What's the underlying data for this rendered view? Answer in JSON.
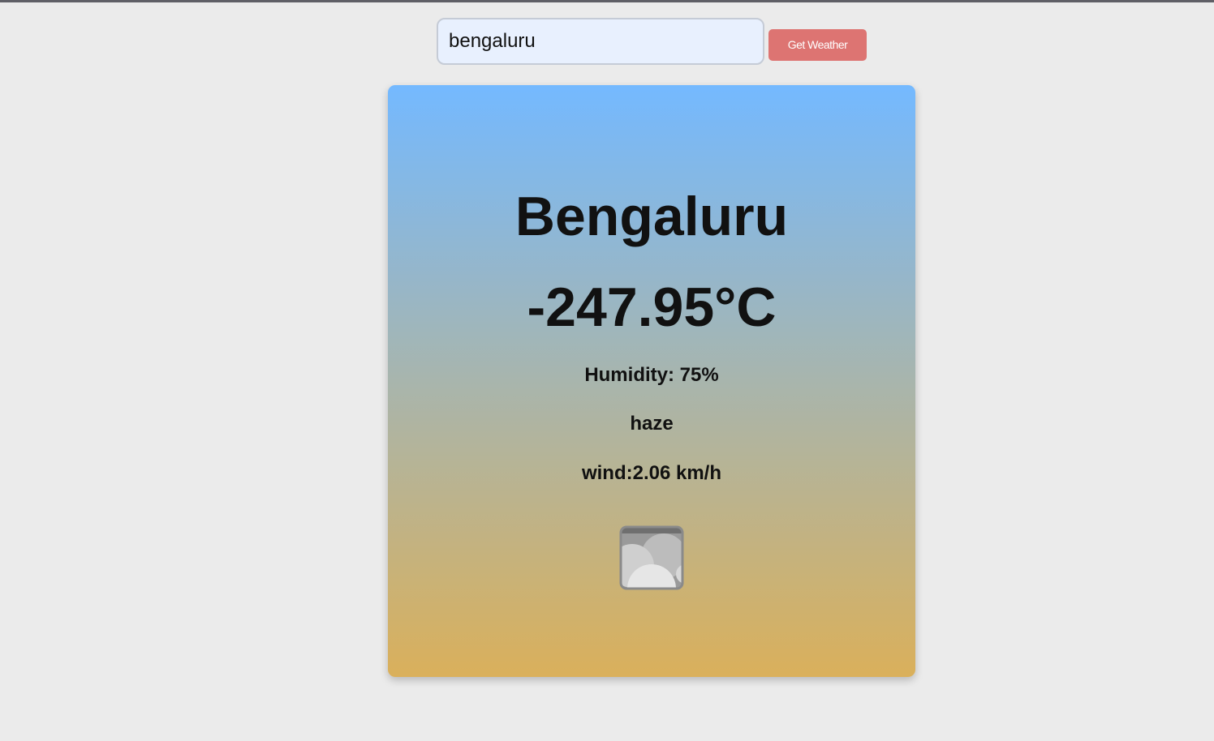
{
  "search": {
    "value": "bengaluru",
    "button_label": "Get Weather"
  },
  "weather": {
    "city": "Bengaluru",
    "temperature": "-247.95°C",
    "humidity": "Humidity: 75%",
    "description": "haze",
    "wind": "wind:2.06 km/h",
    "icon": "haze-icon"
  },
  "colors": {
    "background": "#ebebeb",
    "button": "#dd7472",
    "input_background": "#e8f0fe",
    "card_gradient_top": "#74b9ff",
    "card_gradient_bottom": "#dab05b"
  }
}
